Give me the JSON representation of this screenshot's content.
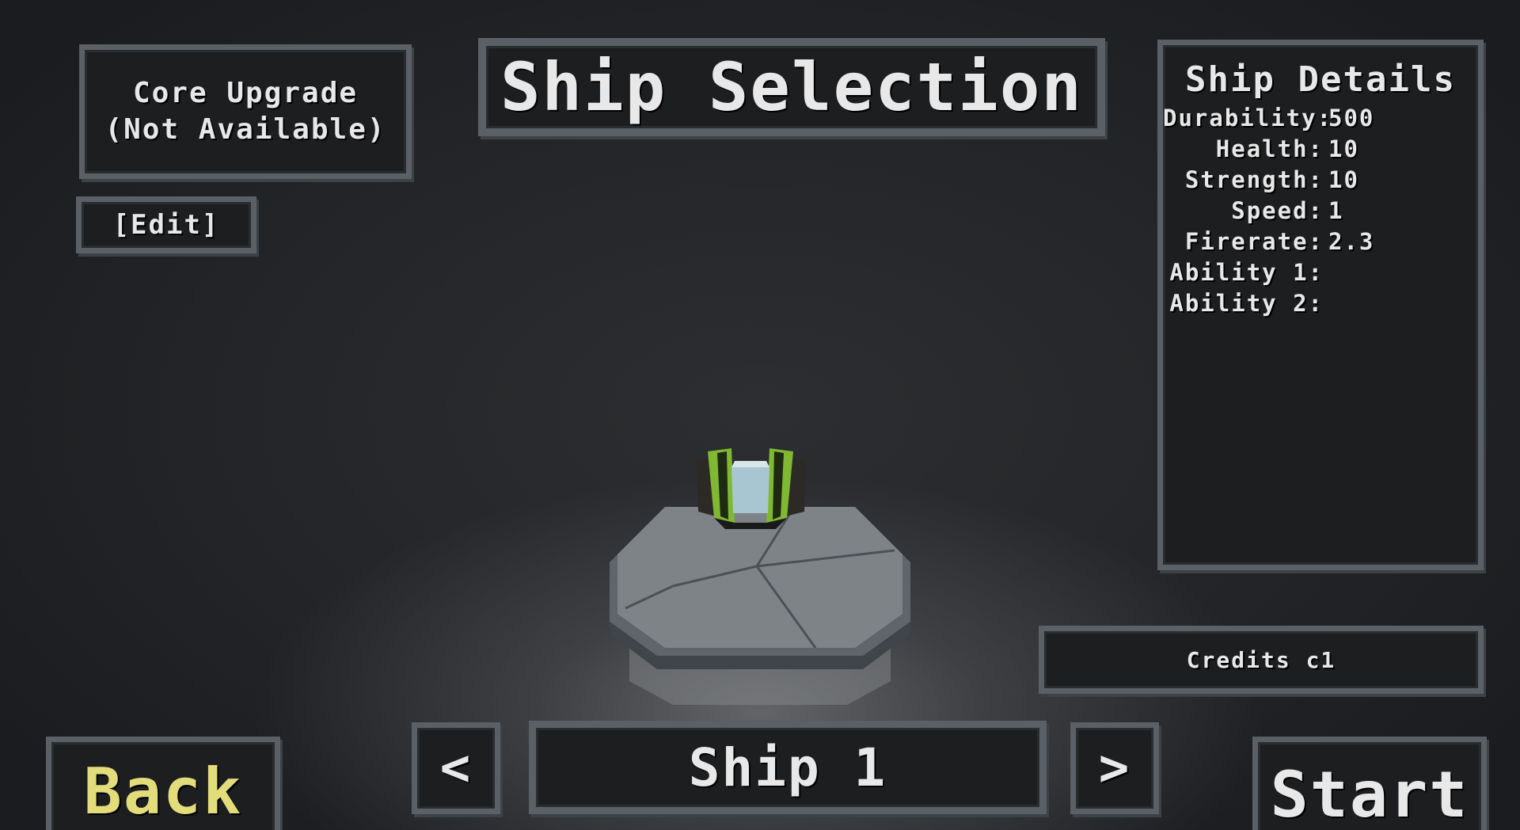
{
  "core_upgrade": {
    "line1": "Core Upgrade",
    "line2": "(Not Available)"
  },
  "edit_label": "[Edit]",
  "title": "Ship Selection",
  "details": {
    "title": "Ship Details",
    "stats": [
      {
        "label": "Durability:",
        "value": "500"
      },
      {
        "label": "Health:",
        "value": "10"
      },
      {
        "label": "Strength:",
        "value": "10"
      },
      {
        "label": "Speed:",
        "value": "1"
      },
      {
        "label": "Firerate:",
        "value": "2.3"
      },
      {
        "label": "Ability 1:",
        "value": ""
      },
      {
        "label": "Ability 2:",
        "value": ""
      }
    ]
  },
  "credits": "Credits c1",
  "back_label": "Back",
  "prev_label": "<",
  "ship_name": "Ship 1",
  "next_label": ">",
  "start_label": "Start",
  "colors": {
    "panel_border": "#5a6066",
    "panel_fill": "#1c1e20",
    "back_text": "#e3dc7a",
    "ship_green": "#7fb832",
    "ship_glass": "#a8c6d2"
  }
}
